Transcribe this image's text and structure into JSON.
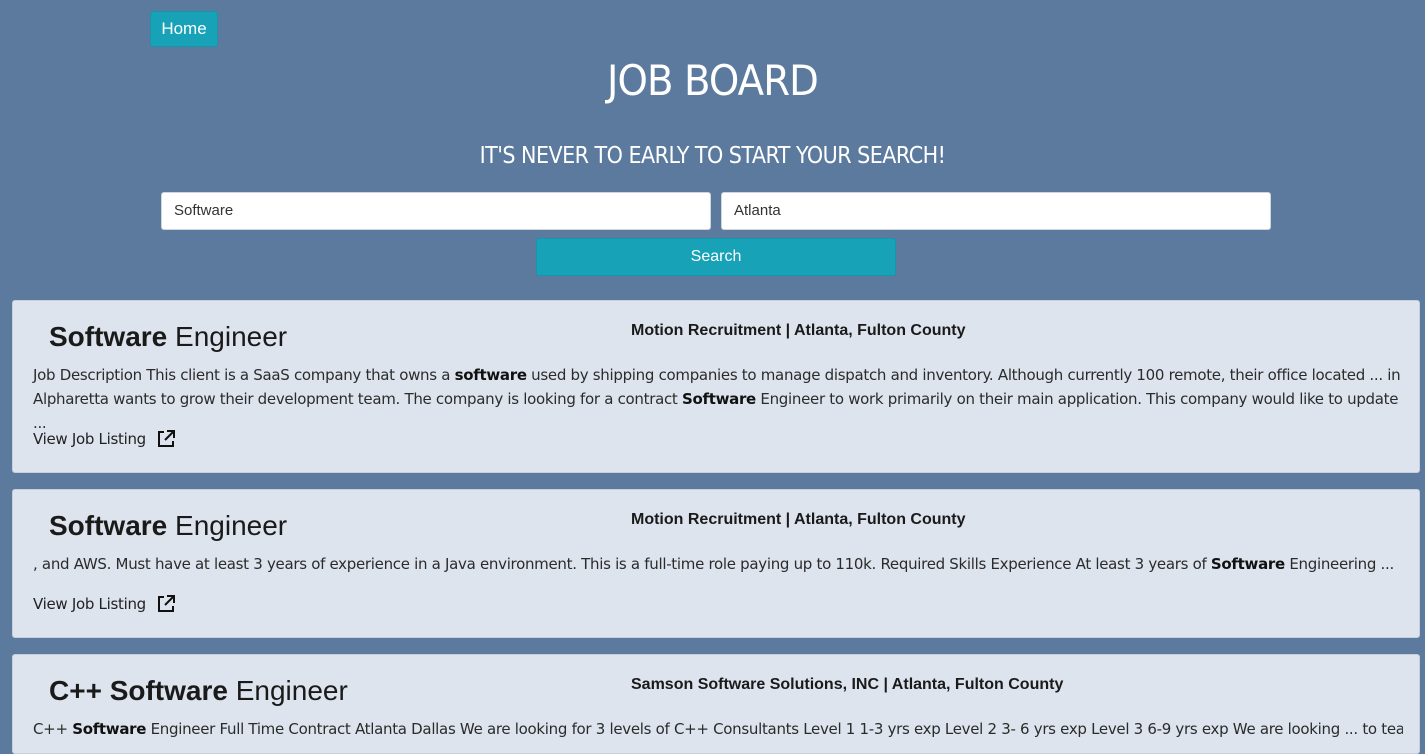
{
  "nav": {
    "home_label": "Home"
  },
  "header": {
    "title": "JOB BOARD",
    "subtitle": "IT'S NEVER TO EARLY TO START YOUR SEARCH!"
  },
  "search": {
    "keyword_value": "Software",
    "location_value": "Atlanta",
    "button_label": "Search"
  },
  "jobs": [
    {
      "title_bold": "Software",
      "title_rest": " Engineer",
      "meta": "Motion Recruitment | Atlanta, Fulton County",
      "desc_parts": [
        "Job Description This client is a SaaS company that owns a ",
        "software",
        " used by shipping companies to manage dispatch and inventory. Although currently 100 remote, their office located ... in Alpharetta wants to grow their development team. The company is looking for a contract ",
        "Software",
        " Engineer to work primarily on their main application. This company would like to update ..."
      ],
      "link_label": "View Job Listing"
    },
    {
      "title_bold": "Software",
      "title_rest": " Engineer",
      "meta": "Motion Recruitment | Atlanta, Fulton County",
      "desc_parts": [
        ", and AWS. Must have at least 3 years of experience in a Java environment. This is a full-time role paying up to 110k. Required Skills Experience At least 3 years of ",
        "Software",
        " Engineering ..."
      ],
      "link_label": "View Job Listing"
    },
    {
      "title_pre": "C++ ",
      "title_bold": "Software",
      "title_rest": " Engineer",
      "meta": "Samson Software Solutions, INC | Atlanta, Fulton County",
      "desc_parts": [
        "C++ ",
        "Software",
        " Engineer Full Time Contract Atlanta Dallas We are looking for 3 levels of C++ Consultants Level 1 1-3 yrs exp Level 2 3- 6 yrs exp Level 3 6-9 yrs exp We are looking ... to teammates through"
      ]
    }
  ],
  "icons": {
    "external_link": "external-link-icon"
  },
  "colors": {
    "background": "#5b7a9e",
    "accent": "#17a2b8",
    "card": "#dde4ee"
  }
}
